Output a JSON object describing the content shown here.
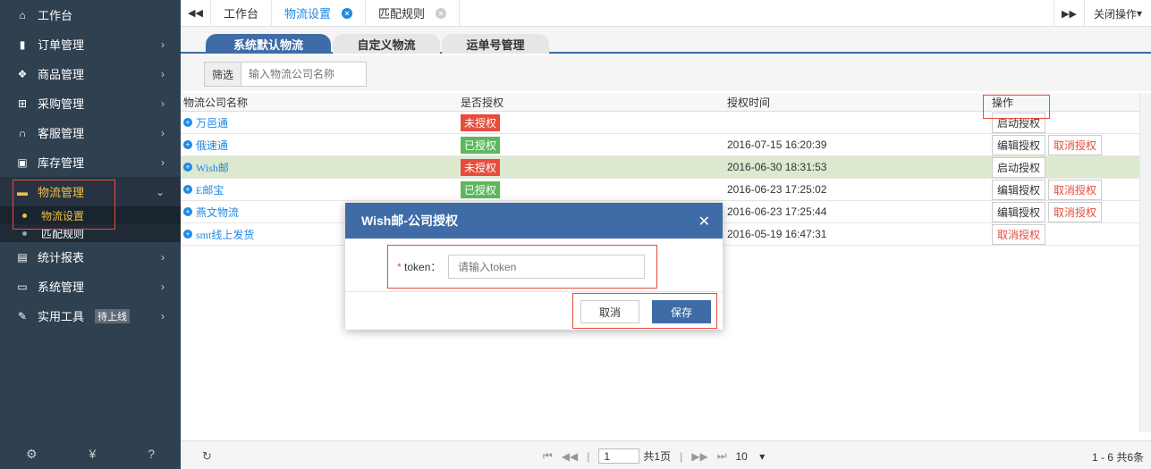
{
  "sidebar": {
    "items": [
      {
        "label": "工作台",
        "icon": "home-icon",
        "glyph": "🏠"
      },
      {
        "label": "订单管理",
        "icon": "clipboard-icon",
        "glyph": "▮"
      },
      {
        "label": "商品管理",
        "icon": "goods-icon",
        "glyph": "❖"
      },
      {
        "label": "采购管理",
        "icon": "cart-icon",
        "glyph": "🛒"
      },
      {
        "label": "客服管理",
        "icon": "headset-icon",
        "glyph": "∩"
      },
      {
        "label": "库存管理",
        "icon": "inventory-icon",
        "glyph": "▣"
      },
      {
        "label": "物流管理",
        "icon": "truck-icon",
        "glyph": "🚚"
      },
      {
        "label": "统计报表",
        "icon": "report-icon",
        "glyph": "▤"
      },
      {
        "label": "系统管理",
        "icon": "monitor-icon",
        "glyph": "▭"
      },
      {
        "label": "实用工具",
        "icon": "wrench-icon",
        "glyph": "🔧"
      }
    ],
    "subitems": [
      "物流设置",
      "匹配规则"
    ],
    "tools_badge": "待上线",
    "footer_icons": [
      "gear-icon",
      "yen-icon",
      "help-icon"
    ]
  },
  "topbar": {
    "tabs": [
      "工作台",
      "物流设置",
      "匹配规则"
    ],
    "close_ops": "关闭操作"
  },
  "subtabs": [
    "系统默认物流",
    "自定义物流",
    "运单号管理"
  ],
  "filter": {
    "label": "筛选",
    "placeholder": "输入物流公司名称"
  },
  "table": {
    "headers": [
      "物流公司名称",
      "是否授权",
      "授权时间",
      "操作"
    ],
    "rows": [
      {
        "name": "万邑通",
        "status": "未授权",
        "status_color": "#e74c3c",
        "time": "",
        "actions": [
          "启动授权"
        ]
      },
      {
        "name": "俄速通",
        "status": "已授权",
        "status_color": "#5cb85c",
        "time": "2016-07-15 16:20:39",
        "actions": [
          "编辑授权",
          "取消授权"
        ]
      },
      {
        "name": "Wish邮",
        "status": "未授权",
        "status_color": "#e74c3c",
        "time": "2016-06-30 18:31:53",
        "actions": [
          "启动授权"
        ]
      },
      {
        "name": "E邮宝",
        "status": "已授权",
        "status_color": "#5cb85c",
        "time": "2016-06-23 17:25:02",
        "actions": [
          "编辑授权",
          "取消授权"
        ]
      },
      {
        "name": "燕文物流",
        "status": "已授权",
        "status_color": "#5cb85c",
        "time": "2016-06-23 17:25:44",
        "actions": [
          "编辑授权",
          "取消授权"
        ]
      },
      {
        "name": "smt线上发货",
        "status": "已授权",
        "status_color": "#5cb85c",
        "time": "2016-05-19 16:47:31",
        "actions": [
          "取消授权"
        ]
      }
    ]
  },
  "pager": {
    "current_page": "1",
    "total_pages": "共1页",
    "page_size": "10",
    "summary": "1 - 6  共6条"
  },
  "modal": {
    "title": "Wish邮-公司授权",
    "field_label": "token：",
    "required_mark": "*",
    "placeholder": "请输入token",
    "cancel": "取消",
    "save": "保存"
  }
}
